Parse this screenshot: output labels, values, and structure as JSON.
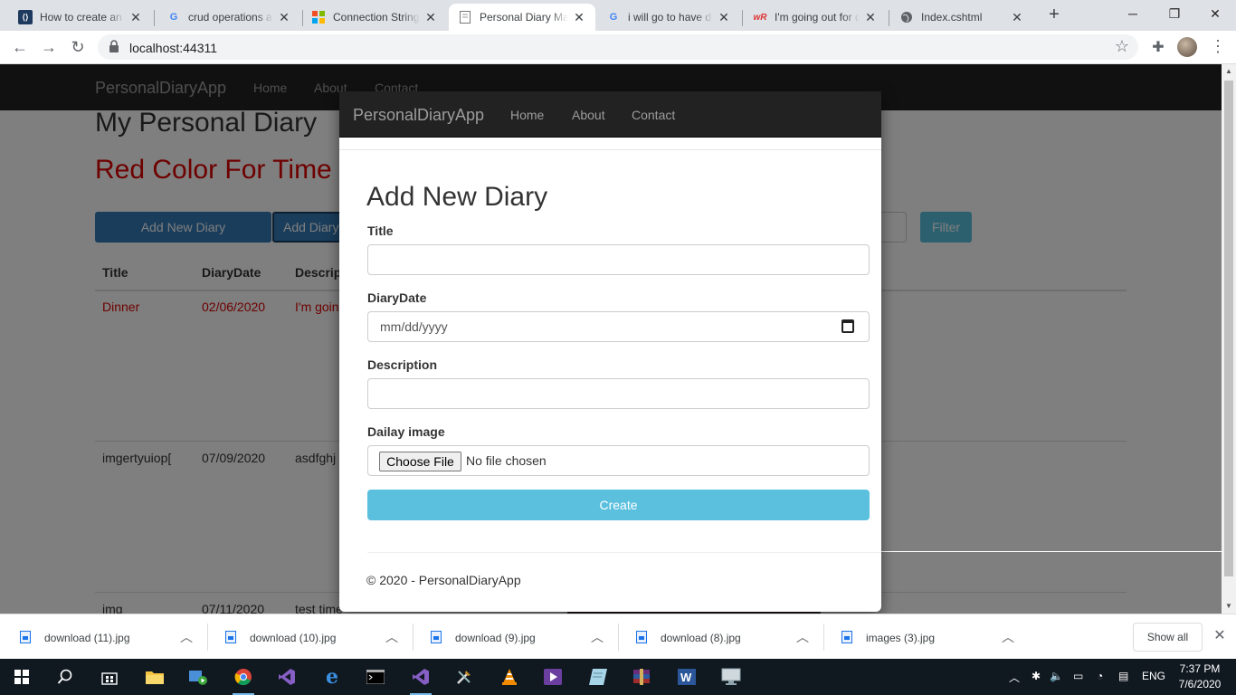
{
  "browser": {
    "tabs": [
      {
        "title": "How to create an e",
        "icon": "dev-icon"
      },
      {
        "title": "crud operations as",
        "icon": "google-icon"
      },
      {
        "title": "Connection String",
        "icon": "microsoft-icon"
      },
      {
        "title": "Personal Diary Ma",
        "icon": "page-icon"
      },
      {
        "title": "i will go to have d",
        "icon": "google-icon"
      },
      {
        "title": "I'm going out for d",
        "icon": "wr-icon"
      },
      {
        "title": "Index.cshtml",
        "icon": "globe-icon"
      }
    ],
    "new_tab": "+",
    "url": "localhost:44311",
    "window_controls": {
      "minimize": "─",
      "maximize": "❐",
      "close": "✕"
    }
  },
  "page": {
    "nav": {
      "brand": "PersonalDiaryApp",
      "links": [
        "Home",
        "About",
        "Contact"
      ]
    },
    "heading": "My Personal Diary",
    "subheading": "Red Color For Time",
    "buttons": {
      "add_new": "Add New Diary",
      "add_diary": "Add Diary",
      "filter": "Filter"
    },
    "table": {
      "headers": [
        "Title",
        "DiaryDate",
        "Descrip"
      ],
      "rows": [
        {
          "title": "Dinner",
          "date": "02/06/2020",
          "desc": "I'm going",
          "red": true
        },
        {
          "title": "imgertyuiop[",
          "date": "07/09/2020",
          "desc": "asdfghj",
          "red": false
        },
        {
          "title": "img",
          "date": "07/11/2020",
          "desc": "test time",
          "red": false
        }
      ]
    }
  },
  "modal": {
    "nav": {
      "brand": "PersonalDiaryApp",
      "links": [
        "Home",
        "About",
        "Contact"
      ]
    },
    "heading": "Add New Diary",
    "fields": {
      "title_label": "Title",
      "title_value": "",
      "date_label": "DiaryDate",
      "date_placeholder": "mm/dd/yyyy",
      "description_label": "Description",
      "description_value": "",
      "image_label": "Dailay image",
      "choose_file": "Choose File",
      "no_file": "No file chosen"
    },
    "create_button": "Create",
    "footer": "© 2020 - PersonalDiaryApp"
  },
  "downloads": {
    "items": [
      "download (11).jpg",
      "download (10).jpg",
      "download (9).jpg",
      "download (8).jpg",
      "images (3).jpg"
    ],
    "show_all": "Show all"
  },
  "taskbar": {
    "language": "ENG",
    "time": "7:37 PM",
    "date": "7/6/2020"
  }
}
